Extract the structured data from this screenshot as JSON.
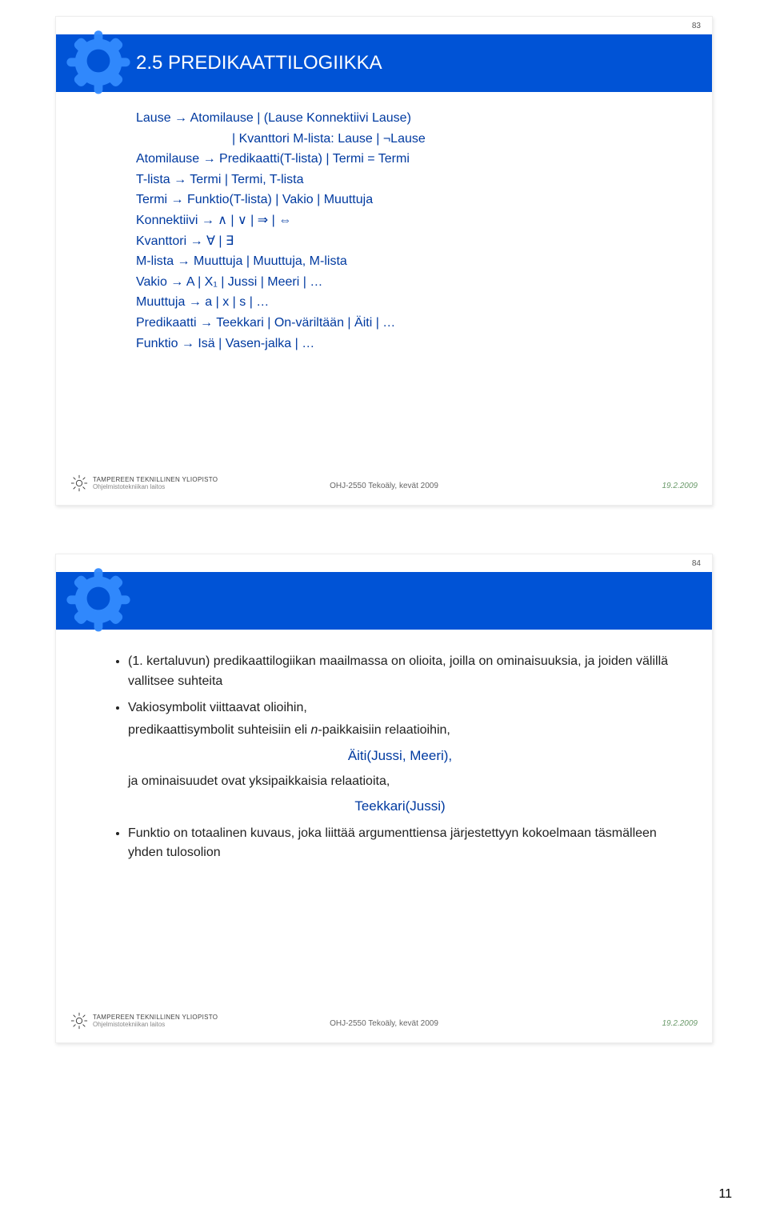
{
  "page_number": "11",
  "slide1": {
    "num": "83",
    "title": "2.5 PREDIKAATTILOGIIKKA",
    "lines": {
      "l1a": "Lause → Atomilause | (Lause Konnektiivi Lause)",
      "l1b": "| Kvanttori M-lista: Lause | ¬Lause",
      "l2": "Atomilause → Predikaatti(T-lista) | Termi = Termi",
      "l3": "T-lista → Termi | Termi, T-lista",
      "l4": "Termi → Funktio(T-lista) | Vakio | Muuttuja",
      "l5": "Konnektiivi → ∧ | ∨ | ⇒ | ⇔",
      "l6": "Kvanttori → ∀ | ∃",
      "l7": "M-lista → Muuttuja | Muuttuja, M-lista",
      "l8": "Vakio → A | X₁ | Jussi | Meeri | …",
      "l9": "Muuttuja → a | x | s | …",
      "l10": "Predikaatti → Teekkari | On-väriltään | Äiti | …",
      "l11": "Funktio → Isä | Vasen-jalka | …"
    }
  },
  "slide2": {
    "num": "84",
    "bullet1": "(1. kertaluvun) predikaattilogiikan maailmassa on olioita, joilla on ominaisuuksia, ja joiden välillä vallitsee suhteita",
    "bullet2a": "Vakiosymbolit viittaavat olioihin,",
    "bullet2b_pre": "predikaattisymbolit suhteisiin eli ",
    "bullet2b_n": "n",
    "bullet2b_post": "-paikkaisiin relaatioihin,",
    "blue1": "Äiti(Jussi, Meeri),",
    "bullet2c": "ja ominaisuudet ovat yksipaikkaisia relaatioita,",
    "blue2": "Teekkari(Jussi)",
    "bullet3": "Funktio on totaalinen kuvaus, joka liittää argumenttiensa järjestettyyn kokoelmaan täsmälleen yhden tulosolion"
  },
  "footer": {
    "uni1": "TAMPEREEN TEKNILLINEN YLIOPISTO",
    "uni2": "Ohjelmistotekniikan laitos",
    "center": "OHJ-2550 Tekoäly, kevät 2009",
    "date": "19.2.2009"
  }
}
